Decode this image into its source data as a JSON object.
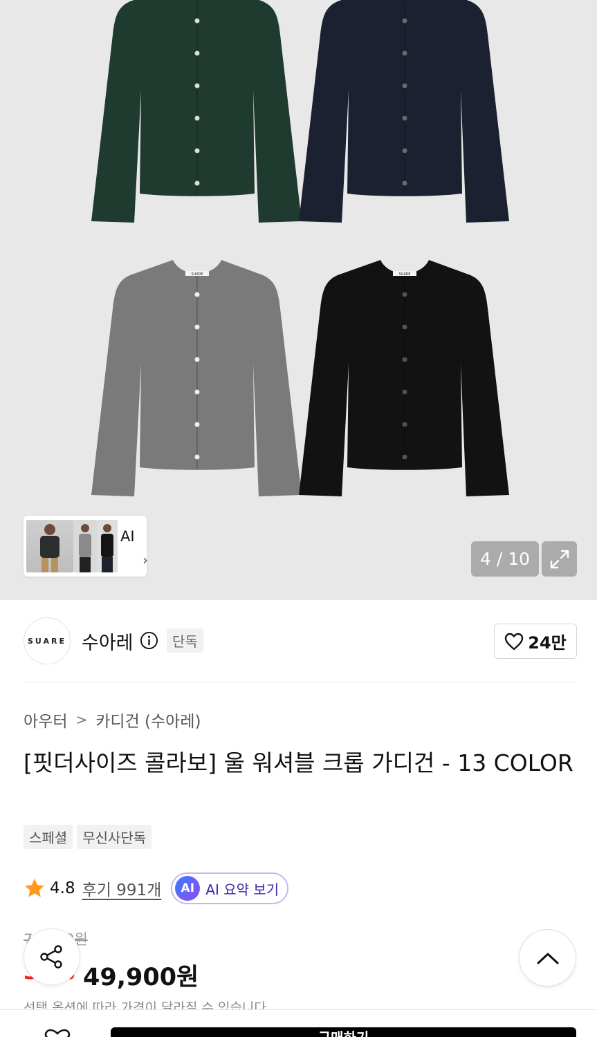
{
  "gallery": {
    "counter": "4 / 10",
    "ai_thumbnail_label": "AI",
    "ai_thumbnail_arrow": "›",
    "garment_label": "SUARE",
    "garments": [
      {
        "color_name": "dark green",
        "hex": "#1f3a2e"
      },
      {
        "color_name": "navy",
        "hex": "#1b2130"
      },
      {
        "color_name": "gray",
        "hex": "#7a7a7a"
      },
      {
        "color_name": "black",
        "hex": "#121212"
      }
    ]
  },
  "brand": {
    "logo_text": "SUARE",
    "name": "수아레",
    "exclusive_tag": "단독",
    "like_count": "24만"
  },
  "product": {
    "breadcrumb": [
      "아우터",
      "카디건 (수아레)"
    ],
    "breadcrumb_separator": ">",
    "title": "[핏더사이즈 콜라보] 울 워셔블 크롭 가디건 - 13 COLOR",
    "tags": [
      "스페셜",
      "무신사단독"
    ],
    "rating": "4.8",
    "reviews": "후기 991개",
    "ai_badge": "AI",
    "ai_summary": "AI 요약 보기"
  },
  "price": {
    "original": "79,900원",
    "discount": "37%",
    "sale": "49,900원",
    "note": "선택 옵션에 따라 가격이 달라질 수 있습니다"
  },
  "bottom_bar": {
    "buy_label": "구매하기"
  },
  "colors": {
    "price_red": "#ff1f1f",
    "ai_purple": "#3b2aa8",
    "background_gray": "#e8e8e8"
  }
}
